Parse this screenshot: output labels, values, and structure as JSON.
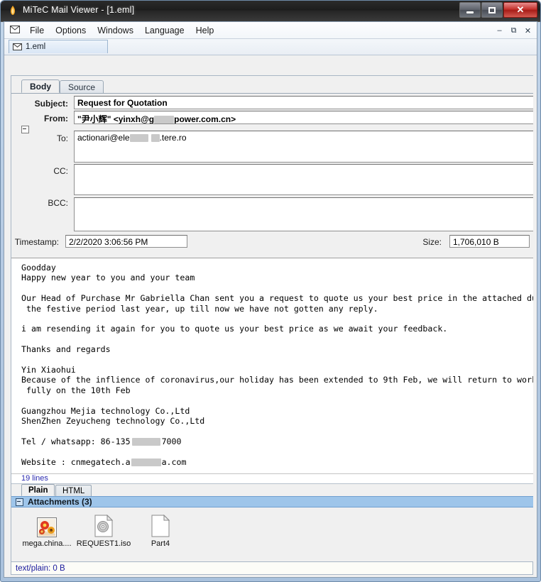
{
  "window": {
    "title": "MiTeC Mail Viewer - [1.eml]",
    "app_icon": "flame-icon",
    "minimize_label": "Minimize",
    "maximize_label": "Maximize",
    "close_label": "✕"
  },
  "menu": {
    "mail_icon": "envelope-icon",
    "items": [
      "File",
      "Options",
      "Windows",
      "Language",
      "Help"
    ],
    "mdi_minimize": "–",
    "mdi_restore": "⧉",
    "mdi_close": "✕"
  },
  "document_tab": {
    "icon": "envelope-icon",
    "label": "1.eml"
  },
  "view_tabs": [
    {
      "label": "Body",
      "active": true
    },
    {
      "label": "Source",
      "active": false
    }
  ],
  "headers": {
    "collapse_icon": "collapse-minus-icon",
    "subject": {
      "label": "Subject:",
      "value": "Request for Quotation"
    },
    "from": {
      "label": "From:",
      "value_prefix": "\"尹小辉\" <yinxh@g",
      "value_suffix": "power.com.cn>",
      "redacted": true
    },
    "to": {
      "label": "To:",
      "value_prefix": "actionari@ele",
      "value_mid": "",
      "value_suffix": ".tere.ro",
      "redacted": true
    },
    "cc": {
      "label": "CC:",
      "value": ""
    },
    "bcc": {
      "label": "BCC:",
      "value": ""
    },
    "timestamp": {
      "label": "Timestamp:",
      "value": "2/2/2020 3:06:56 PM"
    },
    "size": {
      "label": "Size:",
      "value": "1,706,010 B"
    }
  },
  "body": {
    "lines": [
      "Goodday",
      "Happy new year to you and your team",
      "",
      "Our Head of Purchase Mr Gabriella Chan sent you a request to quote us your best price in the attached during",
      " the festive period last year, up till now we have not gotten any reply.",
      "",
      "i am resending it again for you to quote us your best price as we await your feedback.",
      "",
      "Thanks and regards",
      "",
      "Yin Xiaohui",
      "Because of the inflience of coronavirus,our holiday has been extended to 9th Feb, we will return to work",
      " fully on the 10th Feb",
      "",
      "Guangzhou Mejia technology Co.,Ltd",
      "ShenZhen Zeyucheng technology Co.,Ltd",
      "",
      "Tel / whatsapp: 86-135      7000",
      "",
      "Website : cnmegatech.a      a.com"
    ],
    "line_count_label": "19 lines"
  },
  "format_tabs": [
    {
      "label": "Plain",
      "active": true
    },
    {
      "label": "HTML",
      "active": false
    }
  ],
  "attachments": {
    "header_label": "Attachments (3)",
    "toggle_icon": "collapse-minus-icon",
    "items": [
      {
        "name": "mega.china....",
        "icon": "image-thumbnail-icon"
      },
      {
        "name": "REQUEST1.iso",
        "icon": "disc-image-file-icon"
      },
      {
        "name": "Part4",
        "icon": "blank-file-icon"
      }
    ]
  },
  "status": {
    "text": "text/plain: 0 B"
  },
  "colors": {
    "title_bar": "#1d1d1d",
    "close_button": "#c4302b",
    "attachments_header": "#9ec5ea",
    "status_text": "#1a1a9c",
    "window_frame": "#b6cbe3"
  }
}
